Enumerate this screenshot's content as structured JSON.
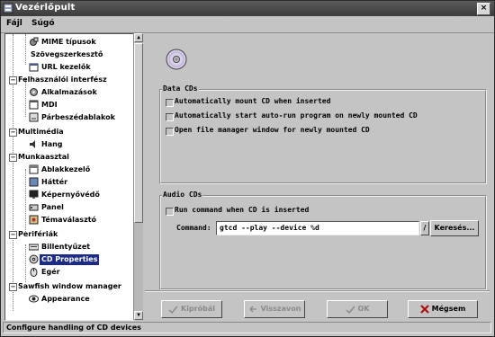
{
  "window": {
    "title": "Vezérlőpult",
    "close_glyph": "×"
  },
  "menubar": {
    "items": [
      "Fájl",
      "Súgó"
    ]
  },
  "tree": {
    "items": [
      {
        "label": "MIME típusok",
        "icon": "mime-icon"
      },
      {
        "label": "Szövegszerkesztő",
        "icon": "none"
      },
      {
        "label": "URL kezelők",
        "icon": "url-icon"
      },
      {
        "label": "Felhasználói interfész",
        "icon": "category-icon"
      },
      {
        "label": "Alkalmazások",
        "icon": "apps-icon"
      },
      {
        "label": "MDI",
        "icon": "mdi-icon"
      },
      {
        "label": "Párbeszédablakok",
        "icon": "dialog-icon"
      },
      {
        "label": "Multimédia",
        "icon": "multimedia-icon"
      },
      {
        "label": "Hang",
        "icon": "sound-icon"
      },
      {
        "label": "Munkaasztal",
        "icon": "desktop-icon"
      },
      {
        "label": "Ablakkezelő",
        "icon": "window-manager-icon"
      },
      {
        "label": "Háttér",
        "icon": "background-icon"
      },
      {
        "label": "Képernyővédő",
        "icon": "screensaver-icon"
      },
      {
        "label": "Panel",
        "icon": "panel-icon"
      },
      {
        "label": "Témaválasztó",
        "icon": "theme-icon"
      },
      {
        "label": "Perifériák",
        "icon": "peripherals-icon"
      },
      {
        "label": "Billentyűzet",
        "icon": "keyboard-icon"
      },
      {
        "label": "CD Properties",
        "icon": "cd-icon",
        "selected": true
      },
      {
        "label": "Egér",
        "icon": "mouse-icon"
      },
      {
        "label": "Sawfish window manager",
        "icon": "sawfish-icon"
      },
      {
        "label": "Appearance",
        "icon": "appearance-icon"
      }
    ]
  },
  "data_cds": {
    "title": "Data CDs",
    "options": [
      {
        "label": "Automatically mount CD when inserted",
        "checked": false
      },
      {
        "label": "Automatically start auto-run program on newly mounted CD",
        "checked": false
      },
      {
        "label": "Open file manager window for newly mounted CD",
        "checked": false
      }
    ]
  },
  "audio_cds": {
    "title": "Audio CDs",
    "run_label": "Run command when CD is inserted",
    "run_checked": false,
    "command_label": "Command:",
    "command_value": "gtcd --play --device %d",
    "browse_label": "Keresés..."
  },
  "buttons": {
    "try": "Kipróbál",
    "revert": "Visszavon",
    "ok": "OK",
    "cancel": "Mégsem"
  },
  "status": {
    "text": "Configure handling of CD devices"
  },
  "colors": {
    "selection": "#1c2a8a",
    "background": "#c4c4c4",
    "titlebar": "#3c3c3c"
  }
}
